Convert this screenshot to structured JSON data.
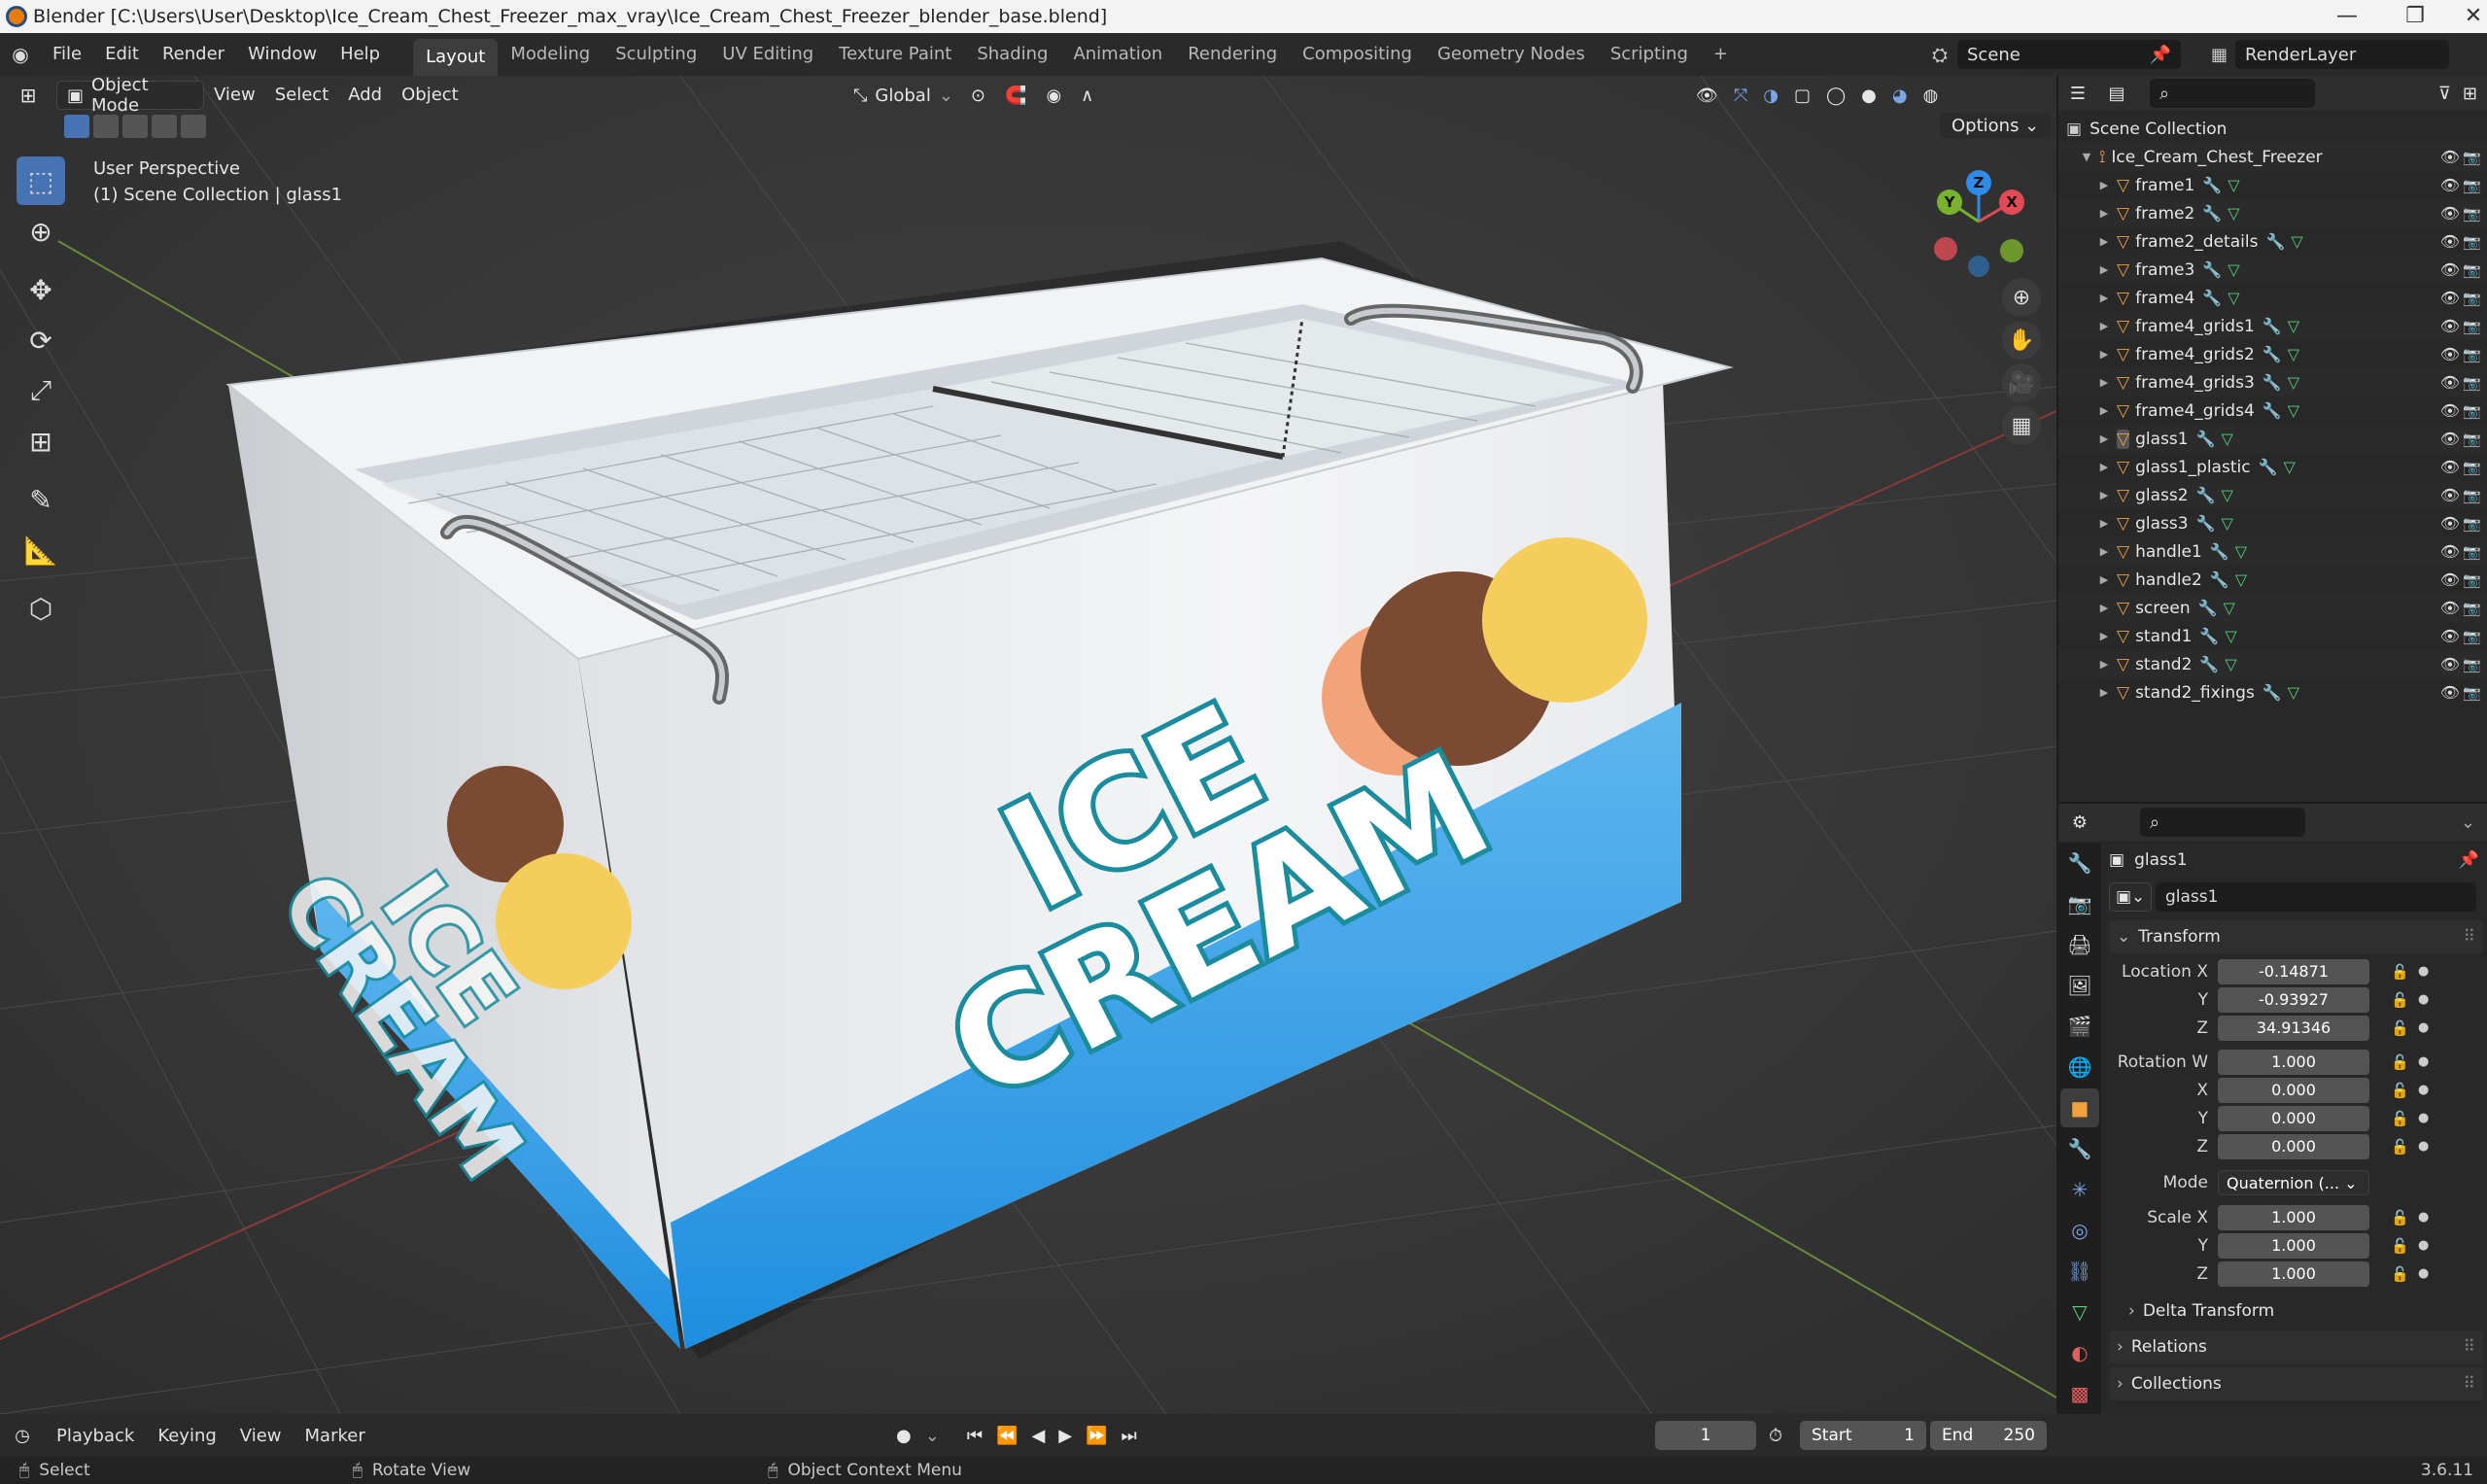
{
  "window": {
    "title": "Blender [C:\\Users\\User\\Desktop\\Ice_Cream_Chest_Freezer_max_vray\\Ice_Cream_Chest_Freezer_blender_base.blend]"
  },
  "menu": [
    "File",
    "Edit",
    "Render",
    "Window",
    "Help"
  ],
  "workspaces": [
    "Layout",
    "Modeling",
    "Sculpting",
    "UV Editing",
    "Texture Paint",
    "Shading",
    "Animation",
    "Rendering",
    "Compositing",
    "Geometry Nodes",
    "Scripting",
    "+"
  ],
  "active_workspace": "Layout",
  "scene": {
    "name": "Scene",
    "view_layer": "RenderLayer"
  },
  "viewport": {
    "mode": "Object Mode",
    "menus": [
      "View",
      "Select",
      "Add",
      "Object"
    ],
    "transform_orientation": "Global",
    "options_label": "Options",
    "overlay_line1": "User Perspective",
    "overlay_line2": "(1) Scene Collection | glass1",
    "gizmo_axes": {
      "x": "X",
      "y": "Y",
      "z": "Z"
    },
    "signage_text": [
      "ICE",
      "CREAM"
    ]
  },
  "outliner": {
    "root": "Scene Collection",
    "collection": "Ice_Cream_Chest_Freezer",
    "objects": [
      "frame1",
      "frame2",
      "frame2_details",
      "frame3",
      "frame4",
      "frame4_grids1",
      "frame4_grids2",
      "frame4_grids3",
      "frame4_grids4",
      "glass1",
      "glass1_plastic",
      "glass2",
      "glass3",
      "handle1",
      "handle2",
      "screen",
      "stand1",
      "stand2",
      "stand2_fixings"
    ],
    "active": "glass1"
  },
  "properties": {
    "object_name": "glass1",
    "datablock": "glass1",
    "transform_label": "Transform",
    "location_label": "Location X",
    "location": {
      "x": "-0.14871",
      "y": "-0.93927",
      "z": "34.91346"
    },
    "rotation_label": "Rotation W",
    "rotation": {
      "w": "1.000",
      "x": "0.000",
      "y": "0.000",
      "z": "0.000"
    },
    "mode_label": "Mode",
    "mode_value": "Quaternion (...",
    "scale_label": "Scale X",
    "scale": {
      "x": "1.000",
      "y": "1.000",
      "z": "1.000"
    },
    "axis_y": "Y",
    "axis_z": "Z",
    "axis_x": "X",
    "delta_transform": "Delta Transform",
    "relations": "Relations",
    "collections": "Collections"
  },
  "timeline": {
    "menus": [
      "Playback",
      "Keying",
      "View",
      "Marker"
    ],
    "current_frame": "1",
    "start_label": "Start",
    "start": "1",
    "end_label": "End",
    "end": "250"
  },
  "statusbar": {
    "select": "Select",
    "rotate": "Rotate View",
    "context": "Object Context Menu",
    "version": "3.6.11"
  }
}
